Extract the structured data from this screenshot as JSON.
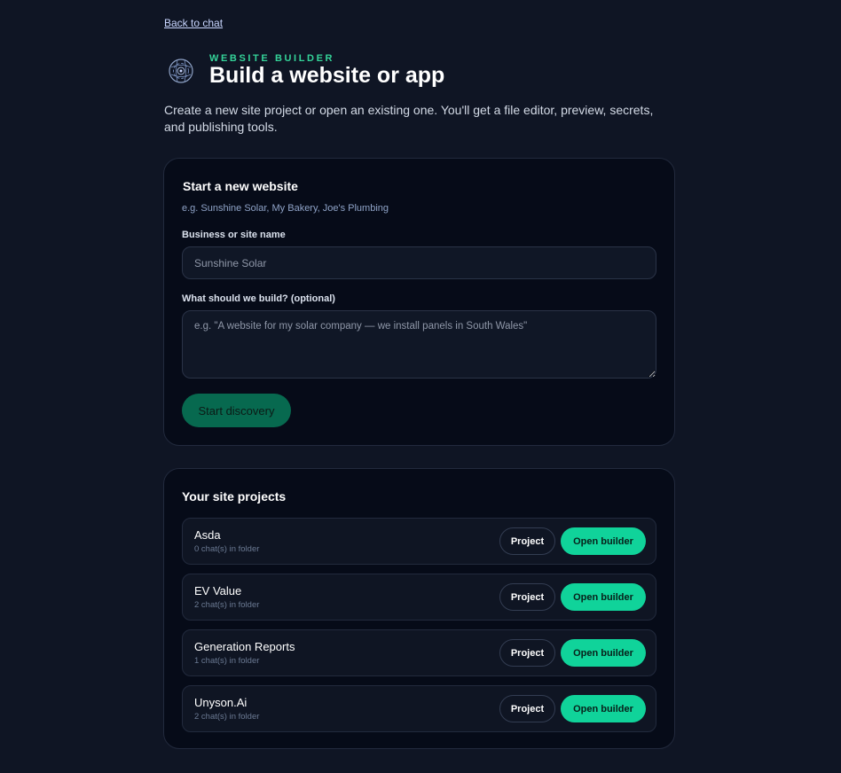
{
  "nav": {
    "back_label": "Back to chat"
  },
  "header": {
    "logo_icon": "globe-circuit-icon",
    "eyebrow": "WEBSITE BUILDER",
    "title": "Build a website or app",
    "description": "Create a new site project or open an existing one. You'll get a file editor, preview, secrets, and publishing tools."
  },
  "new_site": {
    "title": "Start a new website",
    "hint": "e.g. Sunshine Solar, My Bakery, Joe's Plumbing",
    "name_label": "Business or site name",
    "name_placeholder": "Sunshine Solar",
    "build_label": "What should we build? (optional)",
    "build_placeholder": "e.g. \"A website for my solar company — we install panels in South Wales\"",
    "submit_label": "Start discovery"
  },
  "projects": {
    "title": "Your site projects",
    "project_button_label": "Project",
    "open_button_label": "Open builder",
    "items": [
      {
        "name": "Asda",
        "meta": "0 chat(s) in folder"
      },
      {
        "name": "EV Value",
        "meta": "2 chat(s) in folder"
      },
      {
        "name": "Generation Reports",
        "meta": "1 chat(s) in folder"
      },
      {
        "name": "Unyson.Ai",
        "meta": "2 chat(s) in folder"
      }
    ]
  },
  "colors": {
    "background": "#0f1524",
    "card": "#060b18",
    "accent": "#10d39a",
    "accent_dark": "#07694f",
    "eyebrow": "#34d399"
  }
}
